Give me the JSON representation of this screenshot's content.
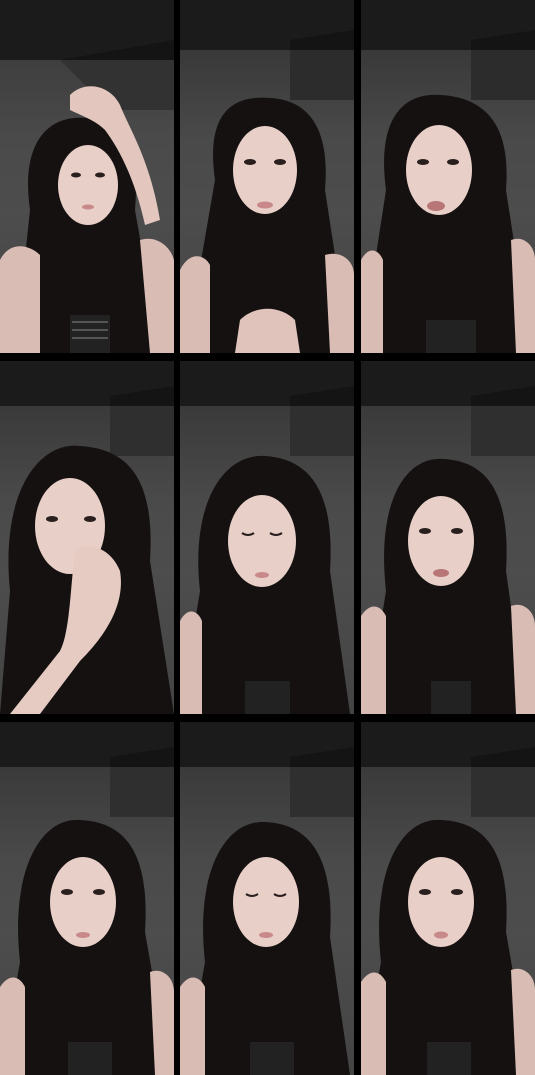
{
  "grid": {
    "rows": 3,
    "columns": 3,
    "frame_count": 9
  },
  "frames": [
    {
      "pose": "hand-raised-to-head",
      "expression": "neutral"
    },
    {
      "pose": "facing-camera",
      "expression": "speaking"
    },
    {
      "pose": "facing-camera",
      "expression": "speaking"
    },
    {
      "pose": "hand-at-nose",
      "expression": "neutral"
    },
    {
      "pose": "eyes-closed",
      "expression": "calm"
    },
    {
      "pose": "facing-camera",
      "expression": "speaking"
    },
    {
      "pose": "facing-camera",
      "expression": "neutral"
    },
    {
      "pose": "eyes-closed",
      "expression": "calm"
    },
    {
      "pose": "facing-camera",
      "expression": "neutral"
    }
  ],
  "colors": {
    "background": "#000000",
    "wall": "#4b4b4b",
    "shelf": "#1a1a1a",
    "hair": "#141111",
    "skin": "#e8cfc8",
    "shadow": "#b99c95",
    "lips": "#c9898a"
  }
}
